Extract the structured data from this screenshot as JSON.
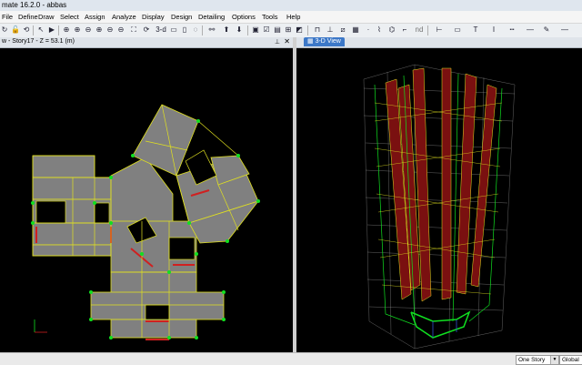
{
  "window": {
    "title": "mate 16.2.0 - abbas"
  },
  "menu": [
    "File",
    "Define",
    "Draw",
    "Select",
    "Assign",
    "Analyze",
    "Display",
    "Design",
    "Detailing",
    "Options",
    "Tools",
    "Help"
  ],
  "plan_view": {
    "title": "w - Story17 - Z = 53.1 (m)"
  },
  "view_3d": {
    "tab_label": "3-D View"
  },
  "toolbar": {
    "three_d_label": "3-d",
    "nd_label": "nd"
  },
  "status": {
    "story_mode": "One Story",
    "coord_system": "Global"
  },
  "colors": {
    "structure": "#808080",
    "beam": "#e0e020",
    "joint": "#10e020",
    "wall": "#d02020",
    "background": "#000000"
  }
}
